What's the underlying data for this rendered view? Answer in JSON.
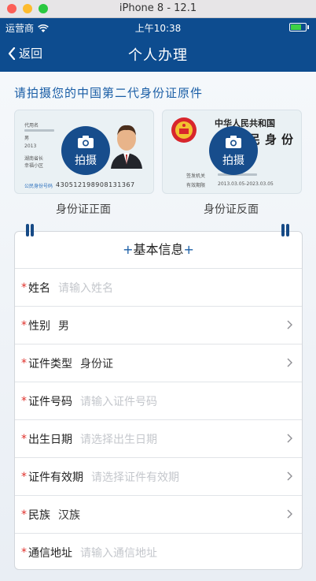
{
  "window": {
    "title": "iPhone 8 - 12.1"
  },
  "status": {
    "carrier": "运营商",
    "time": "上午10:38"
  },
  "nav": {
    "back_label": "返回",
    "title": "个人办理"
  },
  "upload": {
    "title": "请拍摄您的中国第二代身份证原件",
    "photo_label": "拍摄",
    "front_caption": "身份证正面",
    "back_caption": "身份证反面",
    "front_card": {
      "name_label": "代用名",
      "sex_text": "男",
      "birth_text": "2013",
      "addr1": "湖南省长",
      "addr2": "幸福小区",
      "id_label": "公民身份号码",
      "id_number": "430512198908131367"
    },
    "back_card": {
      "heading": "中华人民共和国",
      "big_text": "居民身份证",
      "issuer_label": "签发机关",
      "validity_label": "有效期限",
      "validity_value": "2013.03.05-2023.03.05"
    }
  },
  "form": {
    "header": "基本信息",
    "header_plus": "+",
    "rows": [
      {
        "label": "姓名",
        "value": "请输入姓名",
        "placeholder": true,
        "chevron": false
      },
      {
        "label": "性别",
        "value": "男",
        "placeholder": false,
        "chevron": true
      },
      {
        "label": "证件类型",
        "value": "身份证",
        "placeholder": false,
        "chevron": true
      },
      {
        "label": "证件号码",
        "value": "请输入证件号码",
        "placeholder": true,
        "chevron": false
      },
      {
        "label": "出生日期",
        "value": "请选择出生日期",
        "placeholder": true,
        "chevron": true
      },
      {
        "label": "证件有效期",
        "value": "请选择证件有效期",
        "placeholder": true,
        "chevron": true
      },
      {
        "label": "民族",
        "value": "汉族",
        "placeholder": false,
        "chevron": true
      },
      {
        "label": "通信地址",
        "value": "请输入通信地址",
        "placeholder": true,
        "chevron": false
      }
    ],
    "required_mark": "*"
  },
  "colors": {
    "nav": "#0d4c8f",
    "accent": "#1a5ea6",
    "required": "#e0302b",
    "photo_button": "#174d8c"
  }
}
